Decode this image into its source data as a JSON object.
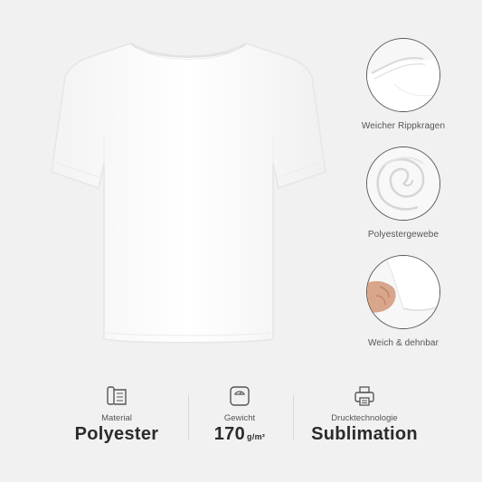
{
  "features": [
    {
      "icon": "collar-closeup-icon",
      "label": "Weicher Rippkragen"
    },
    {
      "icon": "fabric-swirl-icon",
      "label": "Polyestergewebe"
    },
    {
      "icon": "sleeve-stretch-icon",
      "label": "Weich & dehnbar"
    }
  ],
  "specs": {
    "material": {
      "icon": "fabric-roll-icon",
      "label": "Material",
      "value": "Polyester"
    },
    "weight": {
      "icon": "scale-icon",
      "label": "Gewicht",
      "value": "170",
      "unit": "g/m²"
    },
    "print": {
      "icon": "printer-icon",
      "label": "Drucktechnologie",
      "value": "Sublimation"
    }
  },
  "colors": {
    "background": "#f1f1f2",
    "shirt": "#ffffff",
    "text": "#2b2b2b"
  }
}
